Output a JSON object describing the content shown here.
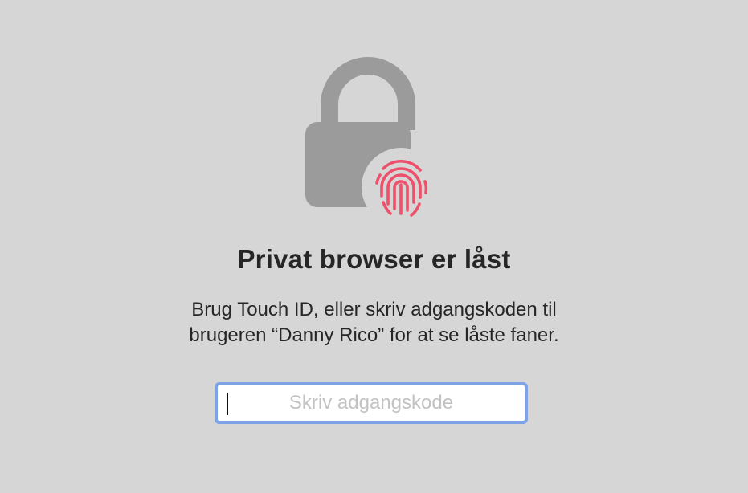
{
  "lock_screen": {
    "icons": {
      "lock": "lock-icon",
      "touch_id": "touch-id-fingerprint-icon"
    },
    "colors": {
      "background": "#d6d6d6",
      "lock": "#9b9b9b",
      "fingerprint": "#ee4f6a",
      "input_focus_ring": "#7da2e6"
    },
    "title": "Privat browser er låst",
    "description_line1": "Brug Touch ID, eller skriv adgangskoden til",
    "description_line2": "brugeren “Danny Rico” for at se låste faner.",
    "password": {
      "value": "",
      "placeholder": "Skriv adgangskode"
    }
  }
}
